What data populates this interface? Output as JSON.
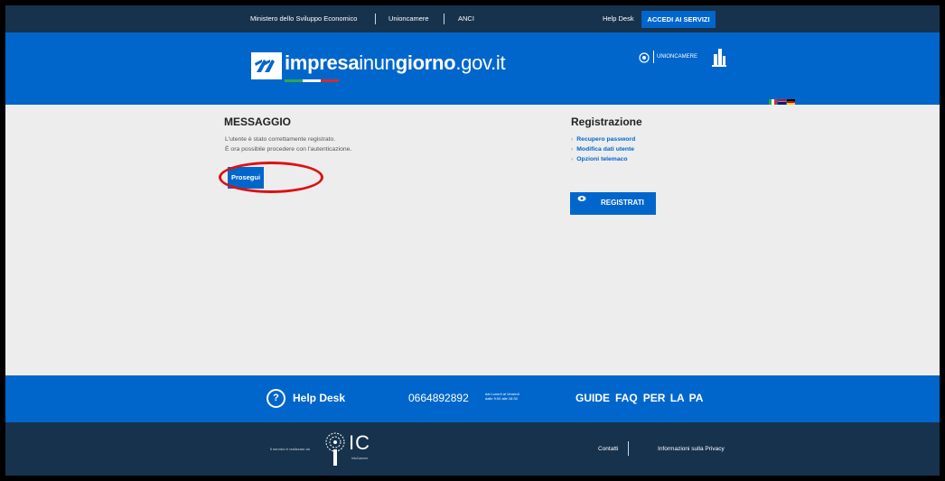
{
  "topbar": {
    "link_ministry": "Ministero dello Sviluppo Economico",
    "link_unioncamere": "Unioncamere",
    "link_anci": "ANCI",
    "link_helpdesk": "Help Desk",
    "access_button": "ACCEDI AI SERVIZI"
  },
  "header": {
    "logo_bold1": "impresa",
    "logo_light1": "inun",
    "logo_bold2": "giorno",
    "logo_light2": ".gov.it",
    "partner_unioncamere": "UNIONCAMERE"
  },
  "message": {
    "title": "MESSAGGIO",
    "line1": "L'utente è stato correttamente registrato.",
    "line2": "È ora possibile procedere con l'autenticazione.",
    "button": "Prosegui"
  },
  "registration": {
    "title": "Registrazione",
    "links": [
      "Recupero password",
      "Modifica dati utente",
      "Opzioni telemaco"
    ],
    "button": "REGISTRATI"
  },
  "footer": {
    "help_label": "Help Desk",
    "phone": "0664892892",
    "phone_hours_line1": "dal Lunedì al Venerdì",
    "phone_hours_line2": "dalle 9:00 alle 18:30",
    "links": [
      "GUIDE",
      "FAQ",
      "PER LA PA"
    ],
    "credit": "Il servizio è realizzato da",
    "ic_logo": "IC",
    "ic_sub": "InfoCamere",
    "contacts": "Contatti",
    "privacy": "Informazioni sulla Privacy"
  },
  "colors": {
    "primary_blue": "#0066cc",
    "dark_navy": "#17324d",
    "highlight_red": "#dd1111"
  }
}
